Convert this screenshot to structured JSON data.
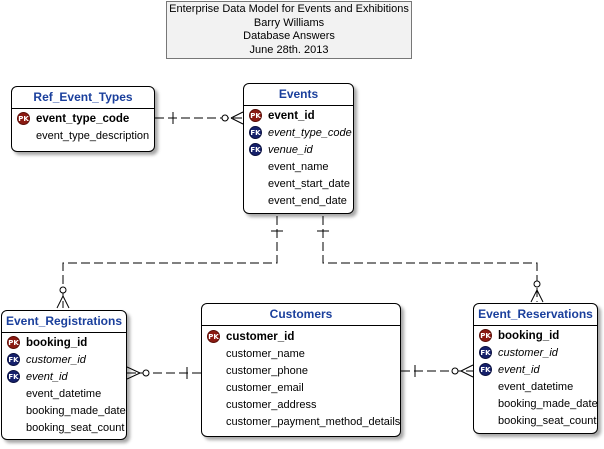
{
  "header": {
    "lines": [
      "Enterprise Data Model for Events and Exhibitions",
      "Barry Williams",
      "Database Answers",
      "June 28th. 2013"
    ]
  },
  "entities": {
    "ref_event_types": {
      "title": "Ref_Event_Types",
      "attributes": [
        {
          "key": "PK",
          "name": "event_type_code"
        },
        {
          "key": "",
          "name": "event_type_description"
        }
      ]
    },
    "events": {
      "title": "Events",
      "attributes": [
        {
          "key": "PK",
          "name": "event_id"
        },
        {
          "key": "FK",
          "name": "event_type_code"
        },
        {
          "key": "FK",
          "name": "venue_id"
        },
        {
          "key": "",
          "name": "event_name"
        },
        {
          "key": "",
          "name": "event_start_date"
        },
        {
          "key": "",
          "name": "event_end_date"
        }
      ]
    },
    "event_registrations": {
      "title": "Event_Registrations",
      "attributes": [
        {
          "key": "PK",
          "name": "booking_id"
        },
        {
          "key": "FK",
          "name": "customer_id"
        },
        {
          "key": "FK",
          "name": "event_id"
        },
        {
          "key": "",
          "name": "event_datetime"
        },
        {
          "key": "",
          "name": "booking_made_date"
        },
        {
          "key": "",
          "name": "booking_seat_count"
        }
      ]
    },
    "customers": {
      "title": "Customers",
      "attributes": [
        {
          "key": "PK",
          "name": "customer_id"
        },
        {
          "key": "",
          "name": "customer_name"
        },
        {
          "key": "",
          "name": "customer_phone"
        },
        {
          "key": "",
          "name": "customer_email"
        },
        {
          "key": "",
          "name": "customer_address"
        },
        {
          "key": "",
          "name": "customer_payment_method_details"
        }
      ]
    },
    "event_reservations": {
      "title": "Event_Reservations",
      "attributes": [
        {
          "key": "PK",
          "name": "booking_id"
        },
        {
          "key": "FK",
          "name": "customer_id"
        },
        {
          "key": "FK",
          "name": "event_id"
        },
        {
          "key": "",
          "name": "event_datetime"
        },
        {
          "key": "",
          "name": "booking_made_date"
        },
        {
          "key": "",
          "name": "booking_seat_count"
        }
      ]
    }
  },
  "key_badges": {
    "pk": "PK",
    "fk": "FK"
  },
  "colors": {
    "title": "#1a3f9c",
    "pk": "#8b1a12",
    "fk": "#15206b",
    "header_bg": "#f2f2f2"
  }
}
